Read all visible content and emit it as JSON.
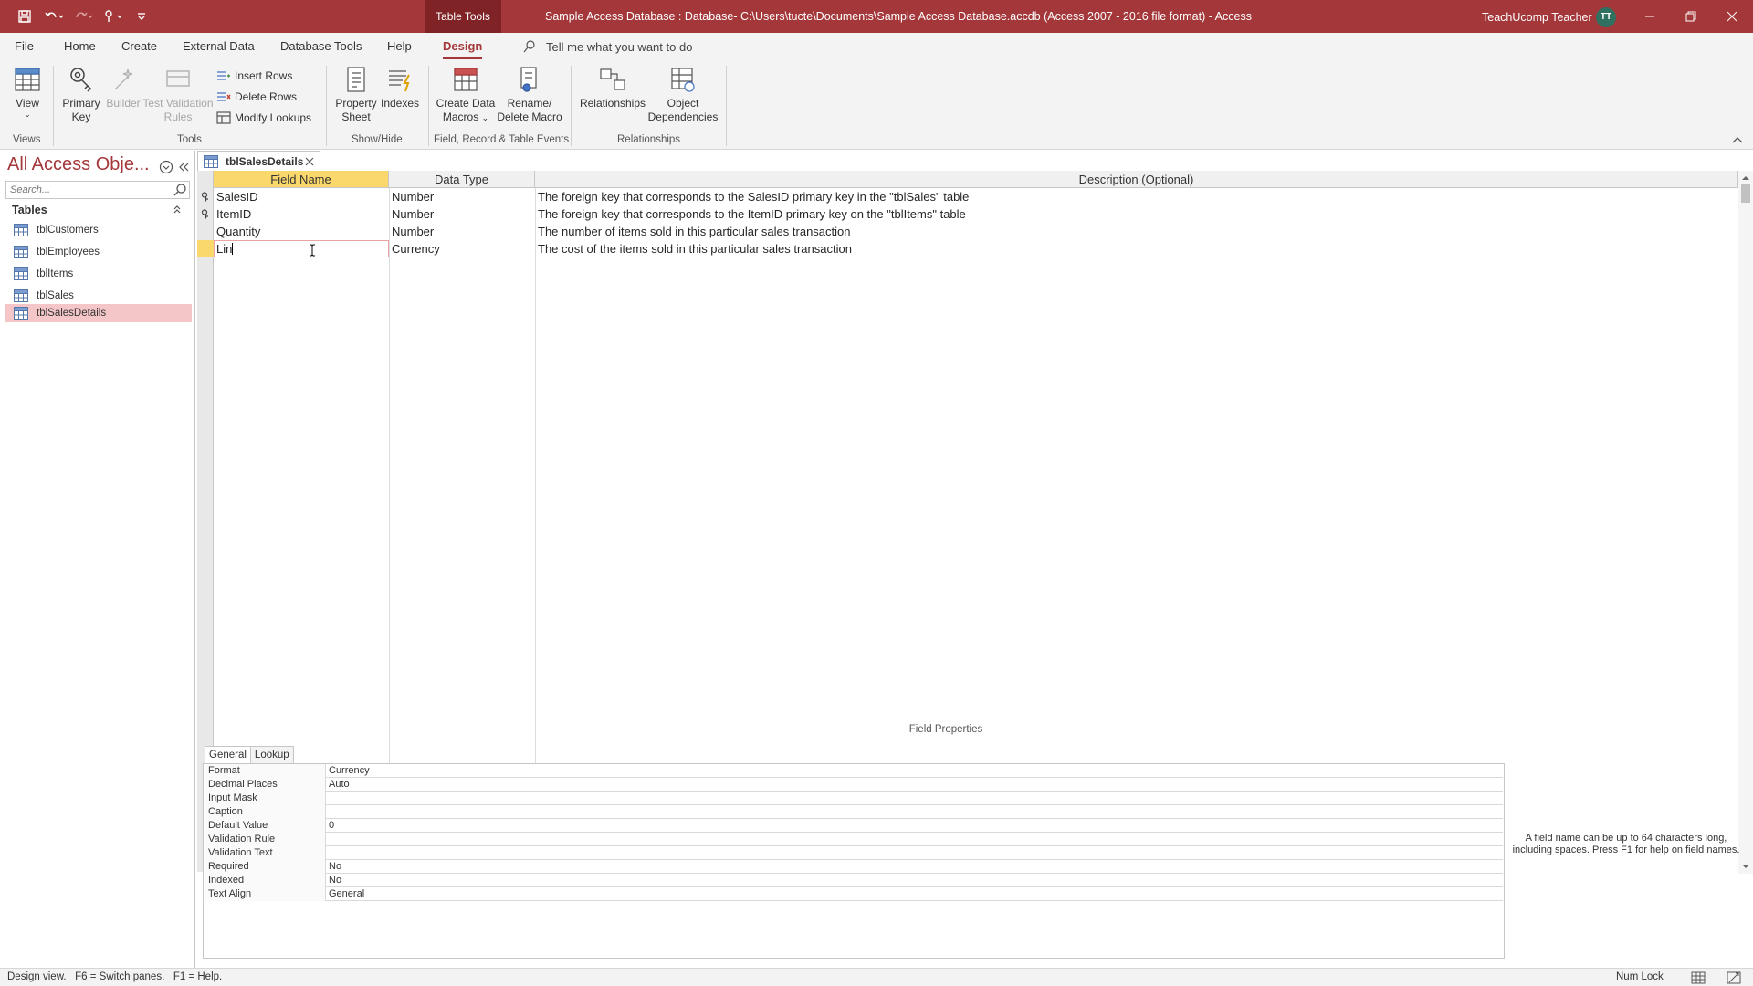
{
  "titlebar": {
    "context_tab": "Table Tools",
    "title": "Sample Access Database : Database- C:\\Users\\tucte\\Documents\\Sample Access Database.accdb (Access 2007 - 2016 file format)  -  Access",
    "user_name": "TeachUcomp Teacher",
    "user_initials": "TT"
  },
  "menu": {
    "tabs": [
      "File",
      "Home",
      "Create",
      "External Data",
      "Database Tools",
      "Help",
      "Design"
    ],
    "active_tab": "Design",
    "tell_me": "Tell me what you want to do"
  },
  "ribbon": {
    "view": "View",
    "primary_key_1": "Primary",
    "primary_key_2": "Key",
    "builder": "Builder",
    "test_validation_1": "Test Validation",
    "test_validation_2": "Rules",
    "insert_rows": "Insert Rows",
    "delete_rows": "Delete Rows",
    "modify_lookups": "Modify Lookups",
    "property_sheet_1": "Property",
    "property_sheet_2": "Sheet",
    "indexes": "Indexes",
    "create_data_macros_1": "Create Data",
    "create_data_macros_2": "Macros",
    "rename_delete_macro_1": "Rename/",
    "rename_delete_macro_2": "Delete Macro",
    "relationships": "Relationships",
    "object_dependencies_1": "Object",
    "object_dependencies_2": "Dependencies",
    "groups": {
      "views": "Views",
      "tools": "Tools",
      "show_hide": "Show/Hide",
      "events": "Field, Record & Table Events",
      "relationships": "Relationships"
    }
  },
  "nav": {
    "header": "All Access Obje...",
    "search_placeholder": "Search...",
    "group": "Tables",
    "items": [
      "tblCustomers",
      "tblEmployees",
      "tblItems",
      "tblSales",
      "tblSalesDetails"
    ],
    "selected": "tblSalesDetails"
  },
  "document": {
    "tab_label": "tblSalesDetails",
    "columns": [
      "Field Name",
      "Data Type",
      "Description (Optional)"
    ],
    "rows": [
      {
        "field": "SalesID",
        "type": "Number",
        "description": "The foreign key that corresponds to the SalesID primary key in the \"tblSales\" table",
        "key": true
      },
      {
        "field": "ItemID",
        "type": "Number",
        "description": "The foreign key that corresponds to the ItemID primary key on the \"tblItems\" table",
        "key": true
      },
      {
        "field": "Quantity",
        "type": "Number",
        "description": "The number of items sold in this particular sales transaction",
        "key": false
      },
      {
        "field": "Lin",
        "type": "Currency",
        "description": "The cost of the items sold in this particular sales transaction",
        "key": false
      }
    ]
  },
  "field_properties": {
    "title": "Field Properties",
    "tabs": [
      "General",
      "Lookup"
    ],
    "active_tab": "General",
    "rows": [
      {
        "name": "Format",
        "value": "Currency"
      },
      {
        "name": "Decimal Places",
        "value": "Auto"
      },
      {
        "name": "Input Mask",
        "value": ""
      },
      {
        "name": "Caption",
        "value": ""
      },
      {
        "name": "Default Value",
        "value": "0"
      },
      {
        "name": "Validation Rule",
        "value": ""
      },
      {
        "name": "Validation Text",
        "value": ""
      },
      {
        "name": "Required",
        "value": "No"
      },
      {
        "name": "Indexed",
        "value": "No"
      },
      {
        "name": "Text Align",
        "value": "General"
      }
    ],
    "help": "A field name can be up to 64 characters long, including spaces. Press F1 for help on field names."
  },
  "status": {
    "text": "Design view.   F6 = Switch panes.   F1 = Help.",
    "num_lock": "Num Lock"
  },
  "colors": {
    "accent": "#a4373a",
    "header_highlight": "#fbd86c",
    "nav_selected": "#f5c6c8"
  }
}
